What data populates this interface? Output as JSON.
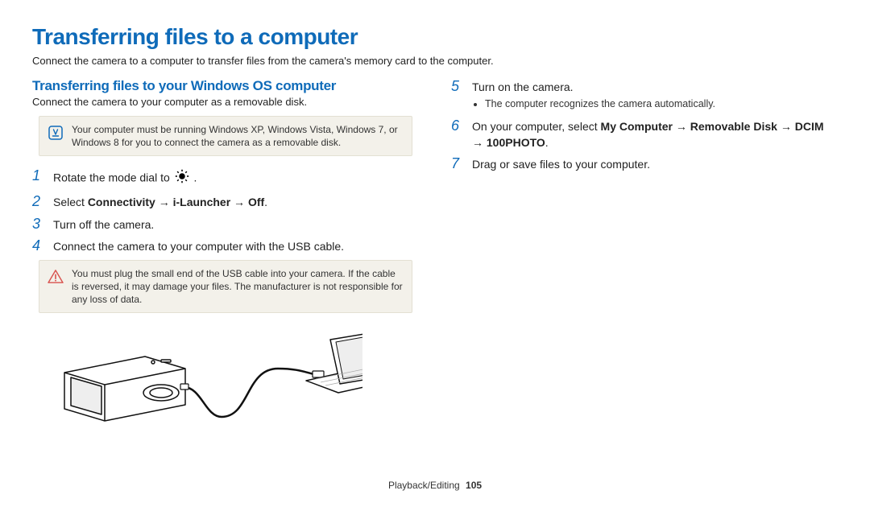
{
  "title": "Transferring files to a computer",
  "intro": "Connect the camera to a computer to transfer files from the camera's memory card to the computer.",
  "section_heading": "Transferring files to your Windows OS computer",
  "section_sub": "Connect the camera to your computer as a removable disk.",
  "note_info": "Your computer must be running Windows XP, Windows Vista, Windows 7, or Windows 8 for you to connect the camera as a removable disk.",
  "note_warning": "You must plug the small end of the USB cable into your camera. If the cable is reversed, it may damage your files. The manufacturer is not responsible for any loss of data.",
  "steps": {
    "1": {
      "num": "1",
      "text_before": "Rotate the mode dial to ",
      "text_after": "."
    },
    "2": {
      "num": "2",
      "lead": "Select ",
      "bold": "Connectivity → i-Launcher → Off",
      "tail": "."
    },
    "3": {
      "num": "3",
      "text": "Turn off the camera."
    },
    "4": {
      "num": "4",
      "text": "Connect the camera to your computer with the USB cable."
    },
    "5": {
      "num": "5",
      "text": "Turn on the camera.",
      "bullet": "The computer recognizes the camera automatically."
    },
    "6": {
      "num": "6",
      "lead": "On your computer, select ",
      "bold1": "My Computer",
      "arrow1": " → ",
      "bold2": "Removable Disk",
      "arrow2": " → ",
      "bold3": "DCIM",
      "arrow3": " → ",
      "bold4": "100PHOTO",
      "tail": "."
    },
    "7": {
      "num": "7",
      "text": "Drag or save files to your computer."
    }
  },
  "footer_section": "Playback/Editing",
  "footer_page": "105"
}
